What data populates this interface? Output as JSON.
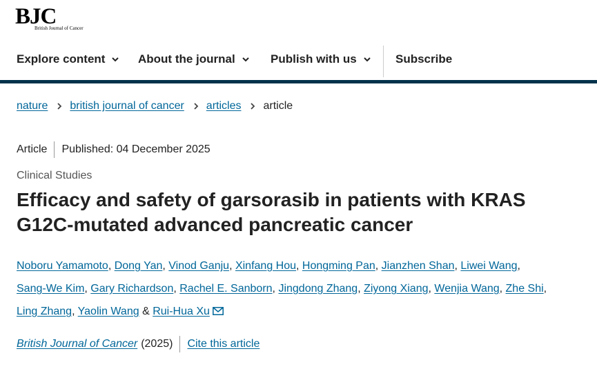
{
  "logo": {
    "main": "BJC",
    "sub": "British Journal of Cancer"
  },
  "nav": {
    "items": [
      "Explore content",
      "About the journal",
      "Publish with us"
    ],
    "subscribe": "Subscribe"
  },
  "breadcrumb": [
    "nature",
    "british journal of cancer",
    "articles",
    "article"
  ],
  "meta": {
    "type": "Article",
    "published": "Published: 04 December 2025"
  },
  "subject": "Clinical Studies",
  "title": "Efficacy and safety of garsorasib in patients with KRAS G12C-mutated advanced pancreatic cancer",
  "authors": [
    "Noboru Yamamoto",
    "Dong Yan",
    "Vinod Ganju",
    "Xinfang Hou",
    "Hongming Pan",
    "Jianzhen Shan",
    "Liwei Wang",
    "Sang-We Kim",
    "Gary Richardson",
    "Rachel E. Sanborn",
    "Jingdong Zhang",
    "Ziyong Xiang",
    "Wenjia Wang",
    "Zhe Shi",
    "Ling Zhang",
    "Yaolin Wang",
    "Rui-Hua Xu"
  ],
  "author_joiner": "&",
  "citation": {
    "journal": "British Journal of Cancer",
    "year": "(2025)",
    "cite": "Cite this article"
  },
  "icons": {
    "chevron": "chevron-down-icon",
    "crumb_sep": "chevron-right-icon",
    "mail": "mail-icon"
  },
  "colors": {
    "link": "#006699",
    "nav_bar": "#01324b"
  }
}
